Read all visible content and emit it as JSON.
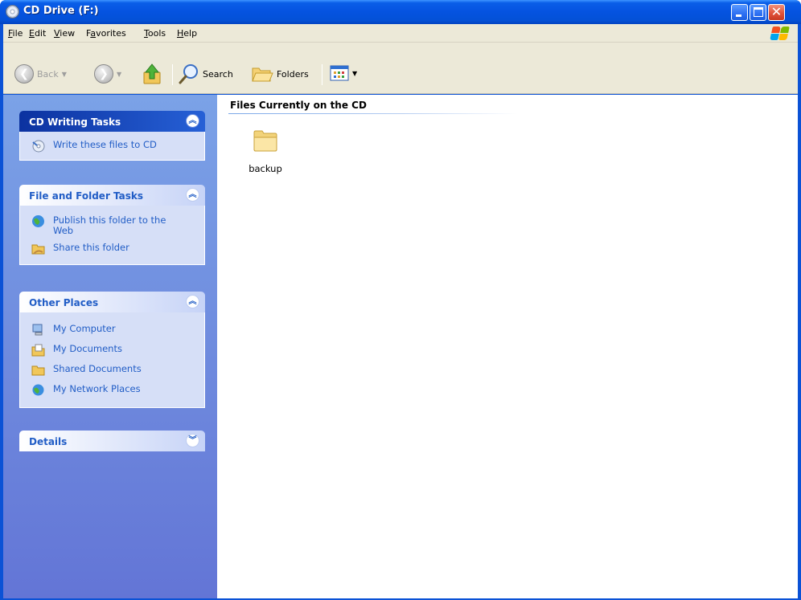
{
  "window": {
    "title": "CD Drive (F:)"
  },
  "menubar": {
    "items": [
      {
        "label": "File",
        "accel": "F",
        "rest": "ile"
      },
      {
        "label": "Edit",
        "accel": "E",
        "rest": "dit"
      },
      {
        "label": "View",
        "accel": "V",
        "rest": "iew"
      },
      {
        "label": "Favorites",
        "pre": "F",
        "accel": "a",
        "rest": "vorites"
      },
      {
        "label": "Tools",
        "accel": "T",
        "rest": "ools"
      },
      {
        "label": "Help",
        "accel": "H",
        "rest": "elp"
      }
    ]
  },
  "toolbar": {
    "back_label": "Back",
    "search_label": "Search",
    "folders_label": "Folders"
  },
  "taskpane": {
    "panels": [
      {
        "title": "CD Writing Tasks",
        "collapsed": false,
        "tasks": [
          {
            "label": "Write these files to CD",
            "icon": "cd-write-icon"
          }
        ]
      },
      {
        "title": "File and Folder Tasks",
        "collapsed": false,
        "tasks": [
          {
            "label": "Publish this folder to the Web",
            "icon": "web-publish-icon"
          },
          {
            "label": "Share this folder",
            "icon": "share-folder-icon"
          }
        ]
      },
      {
        "title": "Other Places",
        "collapsed": false,
        "tasks": [
          {
            "label": "My Computer",
            "icon": "computer-icon"
          },
          {
            "label": "My Documents",
            "icon": "documents-icon"
          },
          {
            "label": "Shared Documents",
            "icon": "shared-folder-icon"
          },
          {
            "label": "My Network Places",
            "icon": "network-icon"
          }
        ]
      },
      {
        "title": "Details",
        "collapsed": true,
        "tasks": []
      }
    ]
  },
  "content": {
    "group_title": "Files Currently on the CD",
    "items": [
      {
        "name": "backup",
        "type": "folder"
      }
    ]
  },
  "colors": {
    "titlebar": "#0553e0",
    "taskpane_link": "#215dc6",
    "panel_body": "#d6dff7",
    "chrome": "#ece9d8"
  }
}
